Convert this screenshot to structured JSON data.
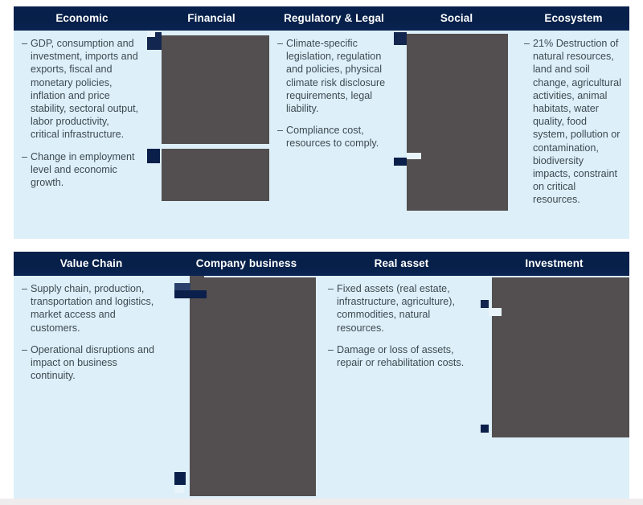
{
  "page": {
    "background_color": "#ffffff",
    "header_color": "#062049",
    "panel_color": "#ddeff8",
    "text_color": "#3d4a52",
    "redaction_color": "#534f50"
  },
  "tables": [
    {
      "id": "climate-risk-drivers",
      "columns": [
        {
          "header": "Economic",
          "bullets": [
            "GDP, consumption and investment, imports and exports, fiscal and monetary policies, inflation and price stability, sectoral output, labor productivity, critical infrastructure.",
            "Change in employment level and economic growth."
          ]
        },
        {
          "header": "Financial",
          "bullets": []
        },
        {
          "header": "Regulatory & Legal",
          "bullets": [
            "Climate-specific legislation, regulation and policies, physical climate risk disclosure requirements, legal liability.",
            "Compliance cost, resources to comply."
          ]
        },
        {
          "header": "Social",
          "bullets": []
        },
        {
          "header": "Ecosystem",
          "bullets": [
            "21% Destruction of natural resources, land and soil change, agricultural activities, animal habitats, water quality, food system, pollution or contamination, biodiversity impacts, constraint on critical resources."
          ]
        }
      ]
    },
    {
      "id": "climate-risk-exposures",
      "columns": [
        {
          "header": "Value Chain",
          "bullets": [
            "Supply chain, production, transportation and logistics, market access and customers.",
            "Operational disruptions and impact on business continuity."
          ]
        },
        {
          "header": "Company business",
          "bullets": []
        },
        {
          "header": "Real asset",
          "bullets": [
            "Fixed assets (real estate, infrastructure, agriculture), commodities, natural resources.",
            "Damage or loss of assets, repair or rehabilitation costs."
          ]
        },
        {
          "header": "Investment",
          "bullets": []
        }
      ]
    }
  ],
  "bullet_marker": "–"
}
